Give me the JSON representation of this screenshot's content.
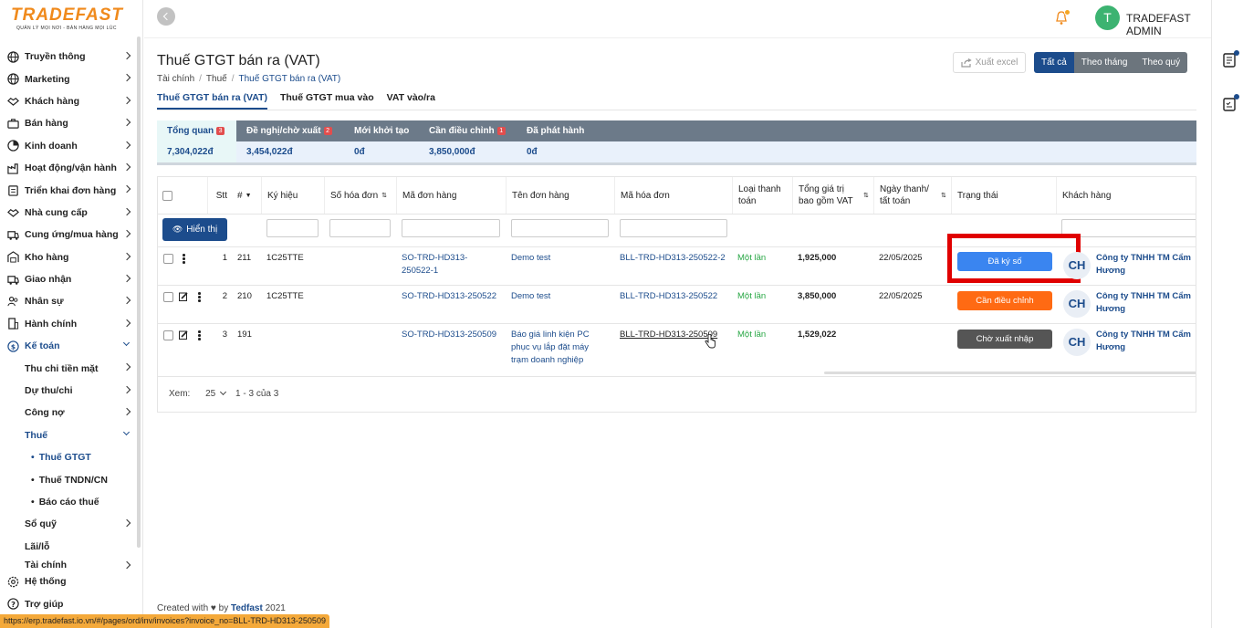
{
  "brand": {
    "name": "TRADEFAST",
    "slogan": "QUẢN LÝ MỌI NƠI - BÁN HÀNG MỌI LÚC",
    "orange": "#f08a1c"
  },
  "colors": {
    "primary": "#1c4c8c",
    "green": "#28a745",
    "orange_btn": "#ff6a13",
    "gray_btn": "#555555",
    "blue_btn": "#3a85f0",
    "highlight": "#e00000"
  },
  "user": {
    "initial": "T",
    "name": "TRADEFAST ADMIN"
  },
  "sidebar": {
    "items": [
      {
        "label": "Truyền thông",
        "icon": "globe-icon"
      },
      {
        "label": "Marketing",
        "icon": "globe-icon"
      },
      {
        "label": "Khách hàng",
        "icon": "handshake-icon"
      },
      {
        "label": "Bán hàng",
        "icon": "briefcase-icon"
      },
      {
        "label": "Kinh doanh",
        "icon": "chart-icon"
      },
      {
        "label": "Hoạt động/vận hành",
        "icon": "factory-icon"
      },
      {
        "label": "Triển khai đơn hàng",
        "icon": "clipboard-icon"
      },
      {
        "label": "Nhà cung cấp",
        "icon": "handshake-icon"
      },
      {
        "label": "Cung ứng/mua hàng",
        "icon": "truck-icon"
      },
      {
        "label": "Kho hàng",
        "icon": "warehouse-icon"
      },
      {
        "label": "Giao nhận",
        "icon": "truck-icon"
      },
      {
        "label": "Nhân sự",
        "icon": "people-icon"
      },
      {
        "label": "Hành chính",
        "icon": "building-icon"
      },
      {
        "label": "Kế toán",
        "icon": "coin-icon"
      }
    ],
    "ketoan_sub": [
      "Thu chi tiền mặt",
      "Dự thu/chi",
      "Công nợ",
      "Thuế"
    ],
    "thue_sub": [
      "Thuế GTGT",
      "Thuế TNDN/CN",
      "Báo cáo thuế"
    ],
    "after": [
      "Sổ quỹ",
      "Lãi/lỗ",
      "Tài chính"
    ],
    "bottom": [
      "Hệ thống",
      "Trợ giúp"
    ]
  },
  "page": {
    "title": "Thuế GTGT bán ra (VAT)",
    "breadcrumb": [
      "Tài chính",
      "Thuế",
      "Thuế GTGT bán ra (VAT)"
    ],
    "excel": "Xuất excel",
    "periods": [
      "Tất cả",
      "Theo tháng",
      "Theo quý"
    ],
    "tabs": [
      "Thuế GTGT bán ra (VAT)",
      "Thuế GTGT mua vào",
      "VAT vào/ra"
    ]
  },
  "summary": [
    {
      "label": "Tổng quan",
      "badge": "3",
      "value": "7,304,022đ"
    },
    {
      "label": "Đề nghị/chờ xuất",
      "badge": "2",
      "value": "3,454,022đ"
    },
    {
      "label": "Mới khởi tạo",
      "badge": "",
      "value": "0đ"
    },
    {
      "label": "Cần điều chỉnh",
      "badge": "1",
      "value": "3,850,000đ"
    },
    {
      "label": "Đã phát hành",
      "badge": "",
      "value": "0đ"
    }
  ],
  "table": {
    "headers": {
      "stt": "Stt",
      "no": "#",
      "kyhieu": "Ký hiệu",
      "sohd": "Số hóa đơn",
      "madon": "Mã đơn hàng",
      "tendon": "Tên đơn hàng",
      "mahd": "Mã hóa đơn",
      "loai": "Loại thanh toán",
      "tong": "Tổng giá trị bao gồm VAT",
      "ngay": "Ngày thanh/ tất toán",
      "trangthai": "Trạng thái",
      "khach": "Khách hàng"
    },
    "show_btn": "Hiển thị",
    "rows": [
      {
        "stt": "1",
        "no": "211",
        "kyhieu": "1C25TTE",
        "madon": "SO-TRD-HD313-250522-1",
        "tendon": "Demo test",
        "mahd": "BLL-TRD-HD313-250522-2",
        "loai": "Một lần",
        "tong": "1,925,000",
        "ngay": "22/05/2025",
        "status": "Đã ký số",
        "avatar": "CH",
        "khach": "Công ty TNHH TM Cẩm Hương"
      },
      {
        "stt": "2",
        "no": "210",
        "kyhieu": "1C25TTE",
        "madon": "SO-TRD-HD313-250522",
        "tendon": "Demo test",
        "mahd": "BLL-TRD-HD313-250522",
        "loai": "Một lần",
        "tong": "3,850,000",
        "ngay": "22/05/2025",
        "status": "Cần điều chỉnh",
        "avatar": "CH",
        "khach": "Công ty TNHH TM Cẩm Hương"
      },
      {
        "stt": "3",
        "no": "191",
        "kyhieu": "",
        "madon": "SO-TRD-HD313-250509",
        "tendon": "Báo giá linh kiện PC phục vụ lắp đặt máy trạm doanh nghiệp",
        "mahd": "BLL-TRD-HD313-250509",
        "loai": "Một lần",
        "tong": "1,529,022",
        "ngay": "",
        "status": "Chờ xuất nhập",
        "avatar": "CH",
        "khach": "Công ty TNHH TM Cẩm Hương"
      }
    ],
    "pager": {
      "label": "Xem:",
      "size": "25",
      "range": "1 - 3 của 3"
    }
  },
  "footer": {
    "text": "Created with ♥ by",
    "brand": "Tedfast",
    "year": "2021"
  },
  "status_url": "https://erp.tradefast.io.vn/#/pages/ord/inv/invoices?invoice_no=BLL-TRD-HD313-250509"
}
